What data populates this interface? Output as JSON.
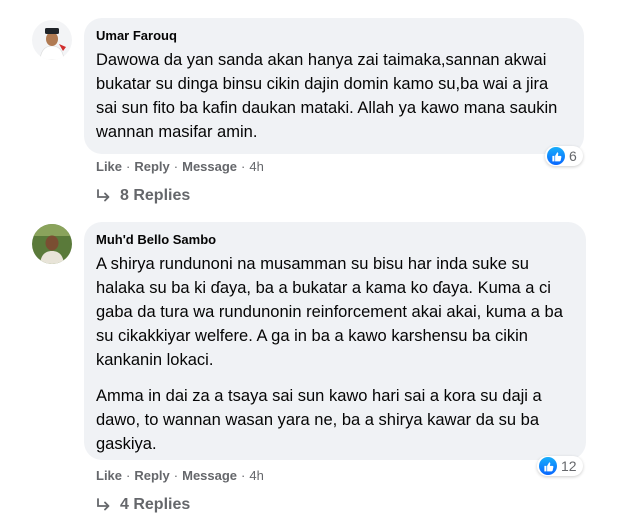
{
  "comments": [
    {
      "author": "Umar Farouq",
      "paragraphs": [
        "Dawowa da yan sanda akan hanya zai taimaka,sannan akwai bukatar su dinga binsu cikin dajin domin kamo su,ba wai a jira sai sun fito ba kafin daukan mataki. Allah ya kawo mana saukin wannan masifar amin."
      ],
      "reaction_count": "6",
      "actions": {
        "like": "Like",
        "reply": "Reply",
        "message": "Message",
        "time": "4h"
      },
      "replies_label": "8 Replies",
      "avatar_colors": {
        "bg": "#f3f4f6",
        "cap": "#1f2328",
        "face": "#b07a52",
        "robe": "#ffffff"
      }
    },
    {
      "author": "Muh'd Bello Sambo",
      "paragraphs": [
        "A shirya rundunoni na musamman su bisu har inda suke su halaka su ba ki ɗaya, ba a bukatar a kama ko ɗaya. Kuma a ci gaba da tura wa rundunonin reinforcement akai akai, kuma a ba su cikakkiyar welfere. A ga in ba a kawo karshensu ba cikin kankanin lokaci.",
        "Amma in dai za a tsaya sai sun kawo hari sai a kora su daji a dawo, to wannan wasan yara ne, ba a shirya kawar da su ba gaskiya."
      ],
      "reaction_count": "12",
      "actions": {
        "like": "Like",
        "reply": "Reply",
        "message": "Message",
        "time": "4h"
      },
      "replies_label": "4 Replies",
      "avatar_colors": {
        "bg": "#5a7a3a",
        "face": "#7a4e32",
        "shirt": "#e8e4d8"
      }
    }
  ],
  "icons": {
    "like": "thumbs-up-icon",
    "replies": "reply-arrow-icon"
  },
  "colors": {
    "bubble": "#f0f2f5",
    "secondary_text": "#65676b",
    "like_blue": "#0866ff"
  }
}
